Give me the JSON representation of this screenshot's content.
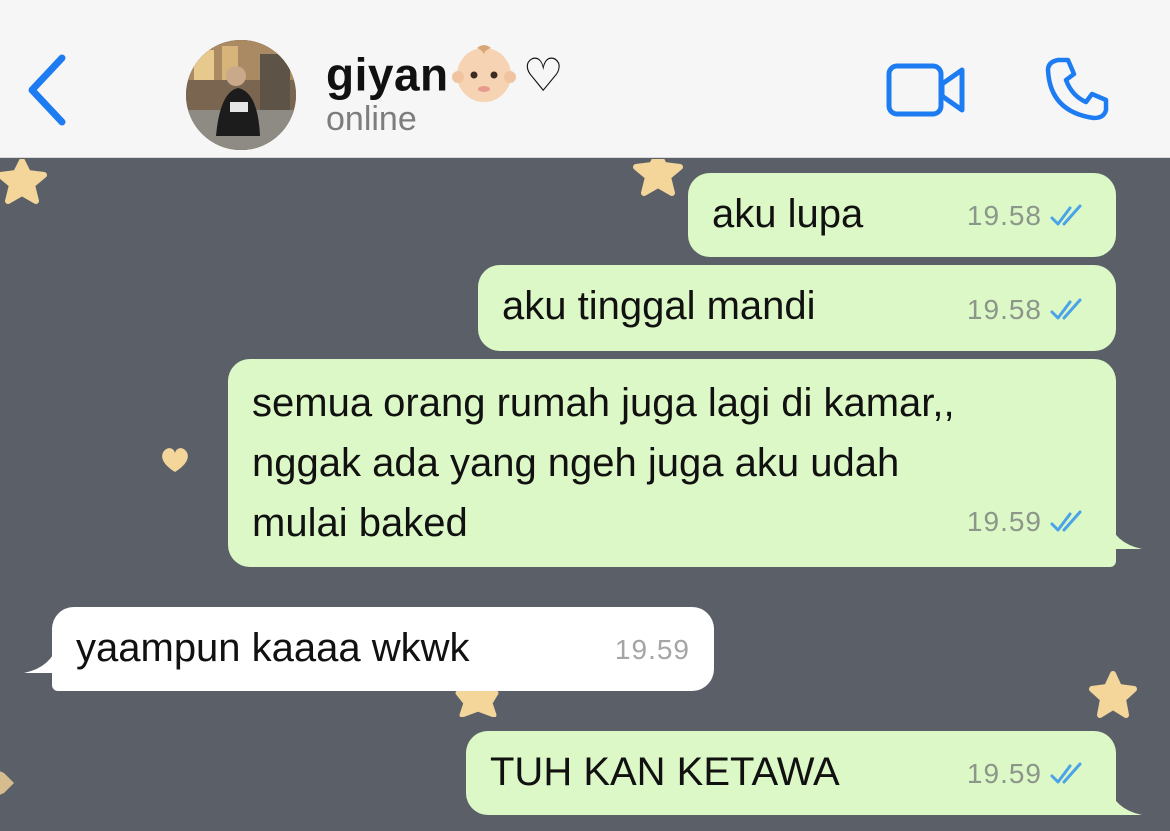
{
  "header": {
    "contact_name": "giyan",
    "name_emoji": "baby-face-emoji",
    "name_symbol": "♡",
    "status": "online",
    "accent_color": "#1e7cf2"
  },
  "messages": [
    {
      "direction": "out",
      "text": "aku lupa",
      "time": "19.58",
      "status": "read"
    },
    {
      "direction": "out",
      "text": "aku tinggal mandi",
      "time": "19.58",
      "status": "read"
    },
    {
      "direction": "out",
      "text": "semua orang rumah juga lagi di kamar,,\nnggak ada yang ngeh juga aku udah\nmulai baked",
      "time": "19.59",
      "status": "read"
    },
    {
      "direction": "in",
      "text": "yaampun kaaaa wkwk",
      "time": "19.59"
    },
    {
      "direction": "out",
      "text": "TUH KAN KETAWA",
      "time": "19.59",
      "status": "read"
    }
  ],
  "colors": {
    "outgoing_bubble": "#dcf8c6",
    "incoming_bubble": "#ffffff",
    "chat_background": "#5b6068",
    "read_ticks": "#4aa3e8"
  }
}
